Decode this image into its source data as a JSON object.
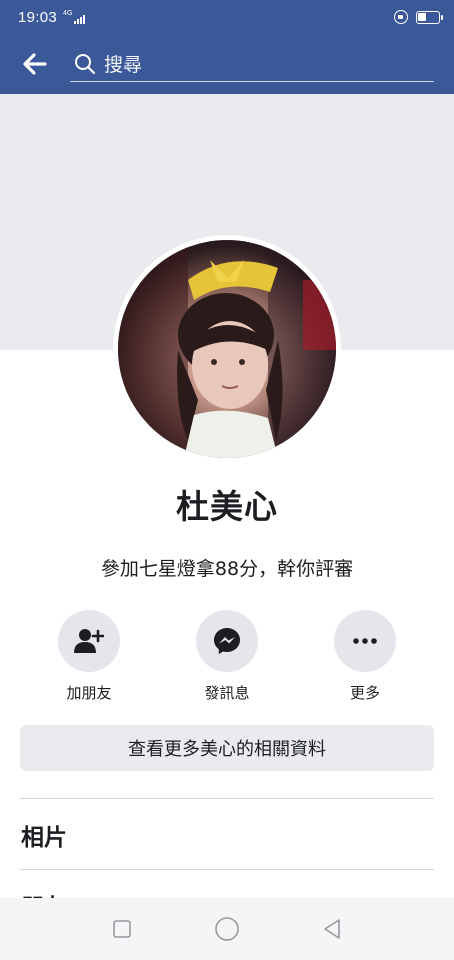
{
  "status_bar": {
    "time": "19:03",
    "network": "4G",
    "signal_icon": "signal-bars-icon",
    "lock_icon": "lock-rotation-icon",
    "battery_icon": "battery-icon"
  },
  "nav": {
    "back_icon": "arrow-left-icon",
    "search_icon": "search-icon",
    "search_placeholder": "搜尋"
  },
  "profile": {
    "name": "杜美心",
    "bio": "參加七星燈拿88分，幹你評審",
    "photo_icon": "profile-photo"
  },
  "actions": [
    {
      "label": "加朋友",
      "icon": "add-friend-icon"
    },
    {
      "label": "發訊息",
      "icon": "messenger-icon"
    },
    {
      "label": "更多",
      "icon": "more-dots-icon"
    }
  ],
  "more_info_label": "查看更多美心的相關資料",
  "sections": {
    "photos_title": "相片",
    "friends_title": "朋友"
  },
  "softkeys": [
    "recent-apps-icon",
    "home-icon",
    "back-triangle-icon"
  ],
  "colors": {
    "brand_blue": "#3b5998",
    "cover_gray": "#e9ebee",
    "button_gray": "#e4e6eb",
    "text": "#1c1e21"
  }
}
